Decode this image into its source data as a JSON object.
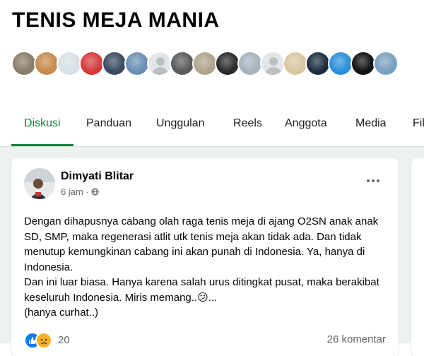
{
  "group": {
    "name": "TENIS MEJA MANIA"
  },
  "member_avatars": [
    {
      "type": "photo",
      "color": "#8a7c6a"
    },
    {
      "type": "photo",
      "color": "#c78a4f"
    },
    {
      "type": "photo",
      "color": "#d8e1e6"
    },
    {
      "type": "photo",
      "color": "#d43a3a"
    },
    {
      "type": "photo",
      "color": "#3b4a62"
    },
    {
      "type": "photo",
      "color": "#6b8fb3"
    },
    {
      "type": "blank"
    },
    {
      "type": "photo",
      "color": "#5a5a5a"
    },
    {
      "type": "photo",
      "color": "#b0a48a"
    },
    {
      "type": "photo",
      "color": "#2b2b2b"
    },
    {
      "type": "photo",
      "color": "#a7b3c0"
    },
    {
      "type": "blank"
    },
    {
      "type": "photo",
      "color": "#d9c7a2"
    },
    {
      "type": "photo",
      "color": "#1d2d3f"
    },
    {
      "type": "photo",
      "color": "#2b8fd9"
    },
    {
      "type": "photo",
      "color": "#111111"
    },
    {
      "type": "photo",
      "color": "#7a9fc1"
    }
  ],
  "tabs": [
    {
      "label": "Diskusi",
      "active": true
    },
    {
      "label": "Panduan",
      "active": false
    },
    {
      "label": "Unggulan",
      "active": false
    },
    {
      "label": "Reels",
      "active": false
    },
    {
      "label": "Anggota",
      "active": false
    },
    {
      "label": "Media",
      "active": false
    },
    {
      "label": "Fil",
      "active": false
    }
  ],
  "post": {
    "author": "Dimyati Blitar",
    "time": "6 jam",
    "visibility_icon": "globe-icon",
    "more_icon": "more-options-icon",
    "body": [
      "Dengan dihapusnya cabang olah raga tenis meja di ajang O2SN anak anak SD, SMP, maka regenerasi atlit utk tenis meja akan tidak ada. Dan tidak menutup kemungkinan cabang ini akan punah di Indonesia. Ya, hanya di Indonesia.",
      "Dan ini luar biasa. Hanya karena salah urus ditingkat pusat, maka berakibat keseluruh Indonesia. Miris memang..😕...",
      "(hanya curhat..)"
    ],
    "reaction_count": "20",
    "comment_count": "26 komentar"
  },
  "colors": {
    "accent": "#1a7f3c",
    "feed_bg": "#ecf2ef",
    "like": "#1877f2",
    "sad": "#f7b125"
  }
}
